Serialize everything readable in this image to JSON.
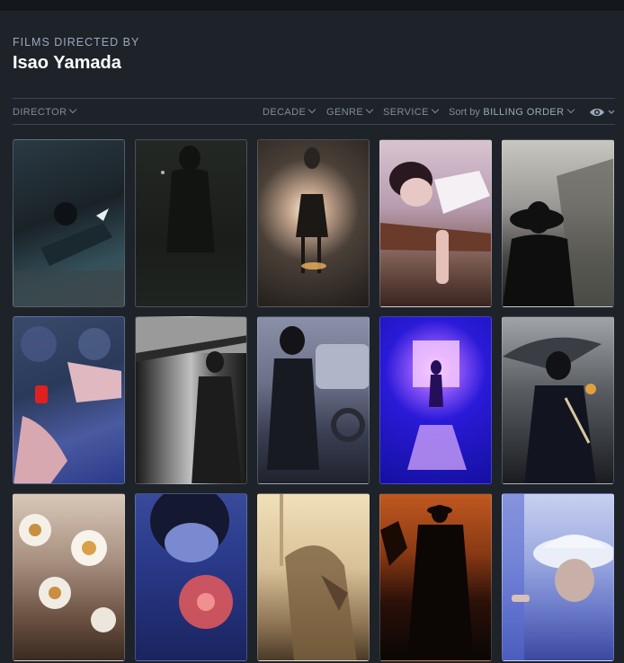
{
  "header": {
    "kicker": "FILMS DIRECTED BY",
    "name": "Isao Yamada"
  },
  "filters": {
    "director": "DIRECTOR",
    "decade": "DECADE",
    "genre": "GENRE",
    "service": "SERVICE",
    "sort_prefix": "Sort by",
    "sort_value": "BILLING ORDER"
  },
  "colors": {
    "background": "#1e232a",
    "topbar": "#14181c",
    "name": "#ffffff",
    "muted": "#99aabb",
    "divider": "#3b4552"
  },
  "eye_icon": "eye-icon"
}
